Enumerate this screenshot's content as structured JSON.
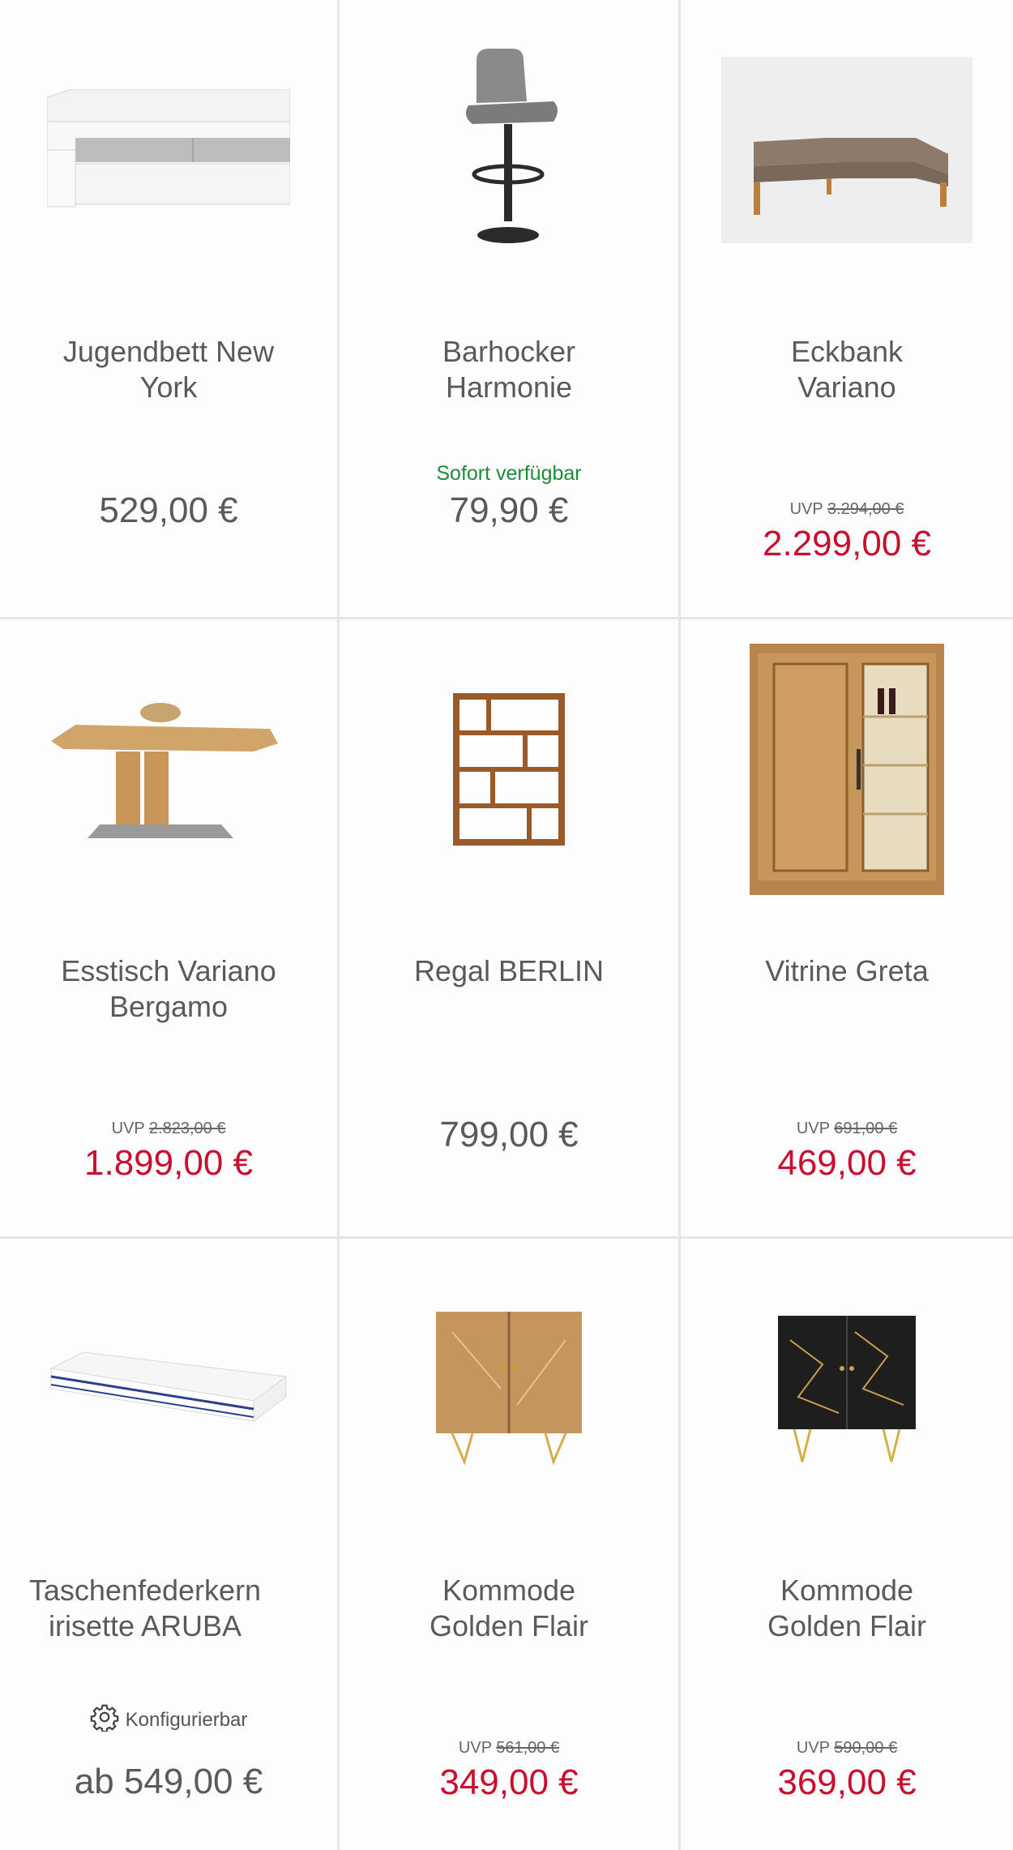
{
  "products": [
    {
      "title": "Jugendbett New\nYork",
      "price": "529,00 €"
    },
    {
      "title": "Barhocker\nHarmonie",
      "availability": "Sofort verfügbar",
      "price": "79,90 €"
    },
    {
      "title": "Eckbank\nVariano",
      "uvp_label": "UVP",
      "uvp_price": "3.294,00 €",
      "price": "2.299,00 €"
    },
    {
      "title": "Esstisch Variano\nBergamo",
      "uvp_label": "UVP",
      "uvp_price": "2.823,00 €",
      "price": "1.899,00 €"
    },
    {
      "title": "Regal BERLIN",
      "price": "799,00 €"
    },
    {
      "title": "Vitrine Greta",
      "uvp_label": "UVP",
      "uvp_price": "691,00 €",
      "price": "469,00 €"
    },
    {
      "title": "Taschenfederkern\nirisette ARUBA",
      "config_label": "Konfigurierbar",
      "price": "ab 549,00 €"
    },
    {
      "title": "Kommode\nGolden Flair",
      "uvp_label": "UVP",
      "uvp_price": "561,00 €",
      "price": "349,00 €"
    },
    {
      "title": "Kommode\nGolden Flair",
      "uvp_label": "UVP",
      "uvp_price": "590,00 €",
      "price": "369,00 €"
    }
  ],
  "colors": {
    "sale": "#c8102e",
    "available": "#1f8a3b",
    "text": "#5a5a5a",
    "divider": "#e5e5e5"
  },
  "icons": {
    "configurable": "gear-icon"
  }
}
